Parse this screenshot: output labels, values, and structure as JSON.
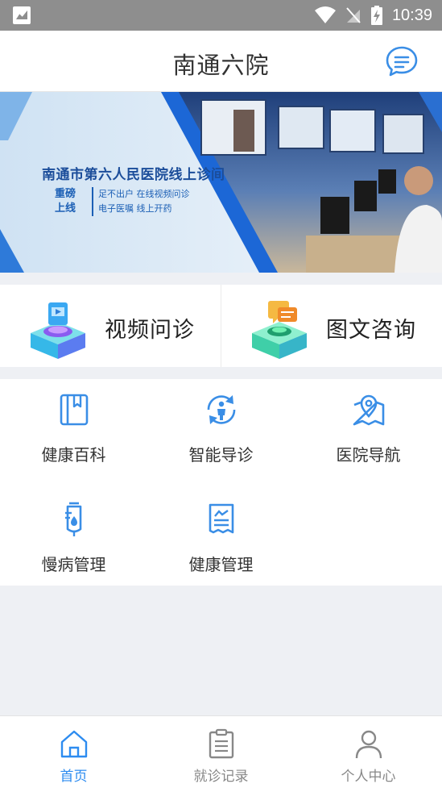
{
  "status_bar": {
    "time": "10:39"
  },
  "header": {
    "title": "南通六院"
  },
  "banner": {
    "title": "南通市第六人民医院线上诊间",
    "tag_line1": "重磅",
    "tag_line2": "上线",
    "sub_line1": "足不出户 在线视频问诊",
    "sub_line2": "电子医嘱 线上开药"
  },
  "big_actions": [
    {
      "label": "视频问诊",
      "icon": "video-consult-icon"
    },
    {
      "label": "图文咨询",
      "icon": "chat-consult-icon"
    }
  ],
  "services": [
    {
      "label": "健康百科",
      "icon": "book-icon"
    },
    {
      "label": "智能导诊",
      "icon": "person-refresh-icon"
    },
    {
      "label": "医院导航",
      "icon": "map-pin-icon"
    },
    {
      "label": "慢病管理",
      "icon": "iv-drip-icon"
    },
    {
      "label": "健康管理",
      "icon": "report-icon"
    }
  ],
  "tabs": [
    {
      "label": "首页",
      "icon": "home-icon",
      "active": true
    },
    {
      "label": "就诊记录",
      "icon": "clipboard-icon",
      "active": false
    },
    {
      "label": "个人中心",
      "icon": "user-icon",
      "active": false
    }
  ],
  "colors": {
    "accent": "#2d8cf0",
    "icon_blue": "#3a8ee6",
    "statusbar": "#8e8e8e"
  }
}
